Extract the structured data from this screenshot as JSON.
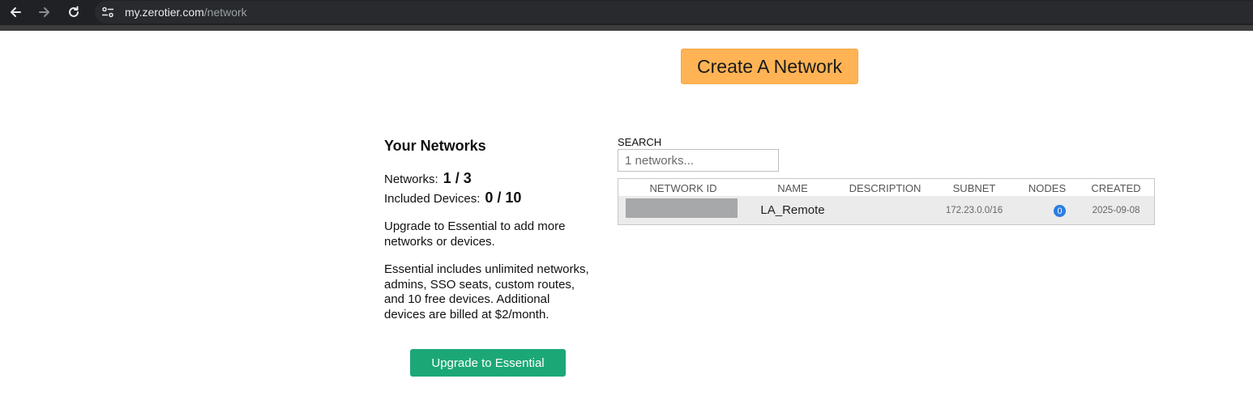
{
  "browser": {
    "back_icon": "arrow-left-icon",
    "forward_icon": "arrow-right-icon",
    "reload_icon": "reload-icon",
    "site_info_icon": "tune-icon",
    "url_host": "my.zerotier.com",
    "url_path": "/network"
  },
  "page": {
    "create_button_label": "Create A Network",
    "sidebar": {
      "title": "Your Networks",
      "networks_label": "Networks:",
      "networks_value": "1 / 3",
      "devices_label": "Included Devices:",
      "devices_value": "0 / 10",
      "upgrade_note": "Upgrade to Essential to add more networks or devices.",
      "essential_note": "Essential includes unlimited networks, admins, SSO seats, custom routes, and 10 free devices. Additional devices are billed at $2/month.",
      "upgrade_button_label": "Upgrade to Essential"
    },
    "search": {
      "label": "SEARCH",
      "placeholder": "1 networks..."
    },
    "table": {
      "columns": [
        "NETWORK ID",
        "NAME",
        "DESCRIPTION",
        "SUBNET",
        "NODES",
        "CREATED"
      ],
      "rows": [
        {
          "network_id": "",
          "name": "LA_Remote",
          "description": "",
          "subnet": "172.23.0.0/16",
          "nodes": "0",
          "created": "2025-09-08"
        }
      ]
    }
  },
  "colors": {
    "create_button": "#ffb354",
    "upgrade_button": "#1ca876",
    "node_badge": "#2b7de1",
    "chrome_bg": "#202124"
  }
}
